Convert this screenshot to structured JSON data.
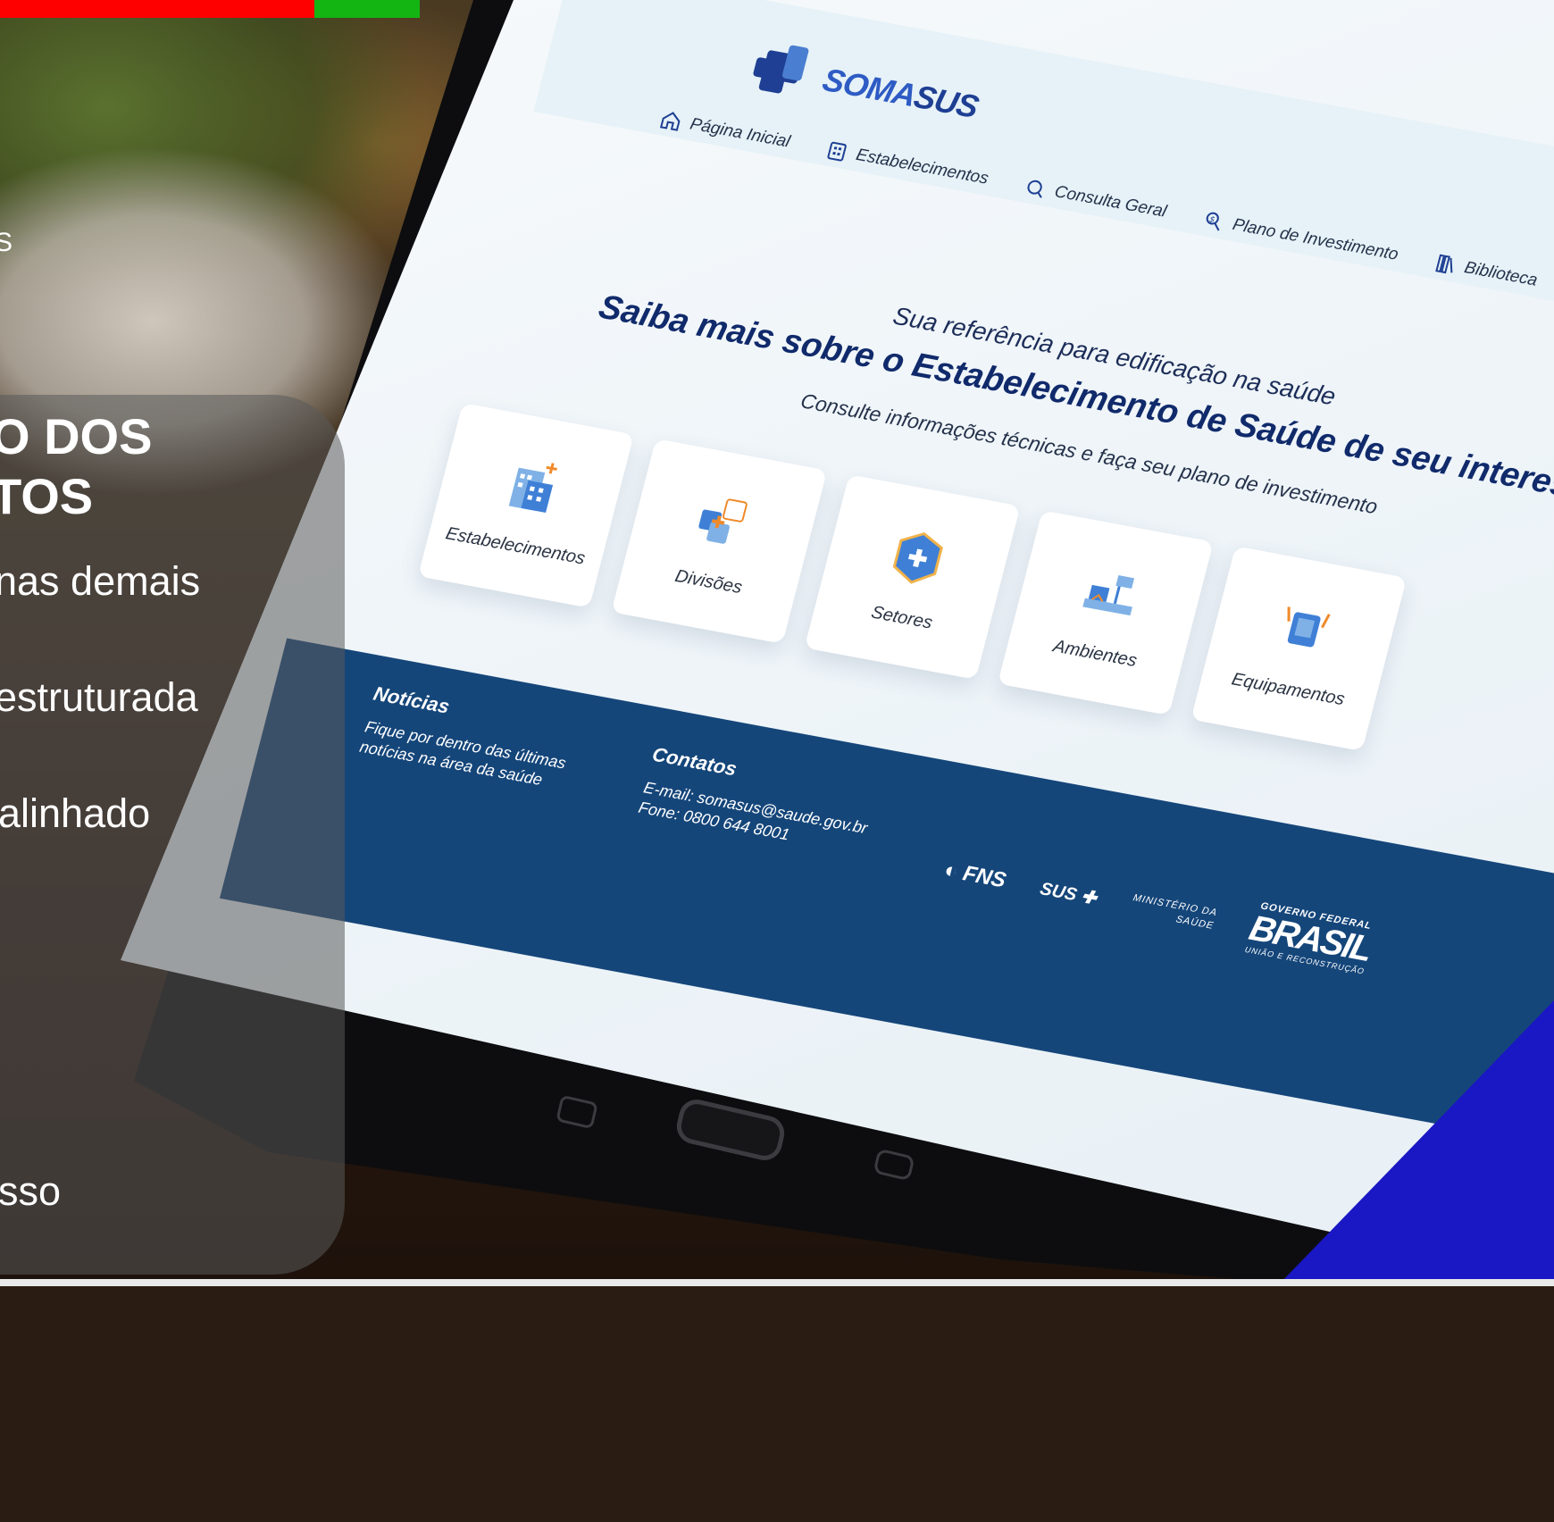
{
  "slide": {
    "small_text": "S",
    "heading_lines": [
      "O DOS",
      "TOS"
    ],
    "bullets": [
      " nas demais",
      " estruturada",
      "alinhado",
      "sso"
    ],
    "accent_colors": {
      "bar_red": "#ff0000",
      "bar_green": "#13b513",
      "corner": "#1a17c4"
    }
  },
  "site": {
    "logo": {
      "prefix": "SOMA",
      "suffix": "SUS"
    },
    "nav": [
      {
        "label": "Página Inicial",
        "icon": "home-icon"
      },
      {
        "label": "Estabelecimentos",
        "icon": "building-icon"
      },
      {
        "label": "Consulta Geral",
        "icon": "search-icon"
      },
      {
        "label": "Plano de Investimento",
        "icon": "investment-icon"
      },
      {
        "label": "Biblioteca",
        "icon": "books-icon"
      }
    ],
    "hero": {
      "tagline": "Sua referência para edificação na saúde",
      "title": "Saiba mais sobre o Estabelecimento de Saúde de seu interesse",
      "subtitle": "Consulte informações técnicas e faça seu plano de investimento"
    },
    "cards": [
      {
        "label": "Estabelecimentos",
        "icon": "hospital-icon"
      },
      {
        "label": "Divisões",
        "icon": "divisions-icon"
      },
      {
        "label": "Setores",
        "icon": "sector-icon"
      },
      {
        "label": "Ambientes",
        "icon": "room-icon"
      },
      {
        "label": "Equipamentos",
        "icon": "equipment-icon"
      }
    ],
    "footer": {
      "news_title": "Notícias",
      "news_text": "Fique por dentro das últimas notícias na área da saúde",
      "contacts_title": "Contatos",
      "email": "E-mail: somasus@saude.gov.br",
      "phone": "Fone: 0800 644 8001",
      "partners": {
        "fns": "FNS",
        "sus": "SUS",
        "ministry_line1": "MINISTÉRIO DA",
        "ministry_line2": "SAÚDE",
        "gov_line1": "GOVERNO FEDERAL",
        "gov_line2": "BRASIL",
        "gov_line3": "UNIÃO E RECONSTRUÇÃO"
      }
    },
    "colors": {
      "primary": "#1e3f93",
      "accent": "#2e5bc4",
      "footer": "#15467a",
      "header_band": "#e6f2f7"
    }
  }
}
